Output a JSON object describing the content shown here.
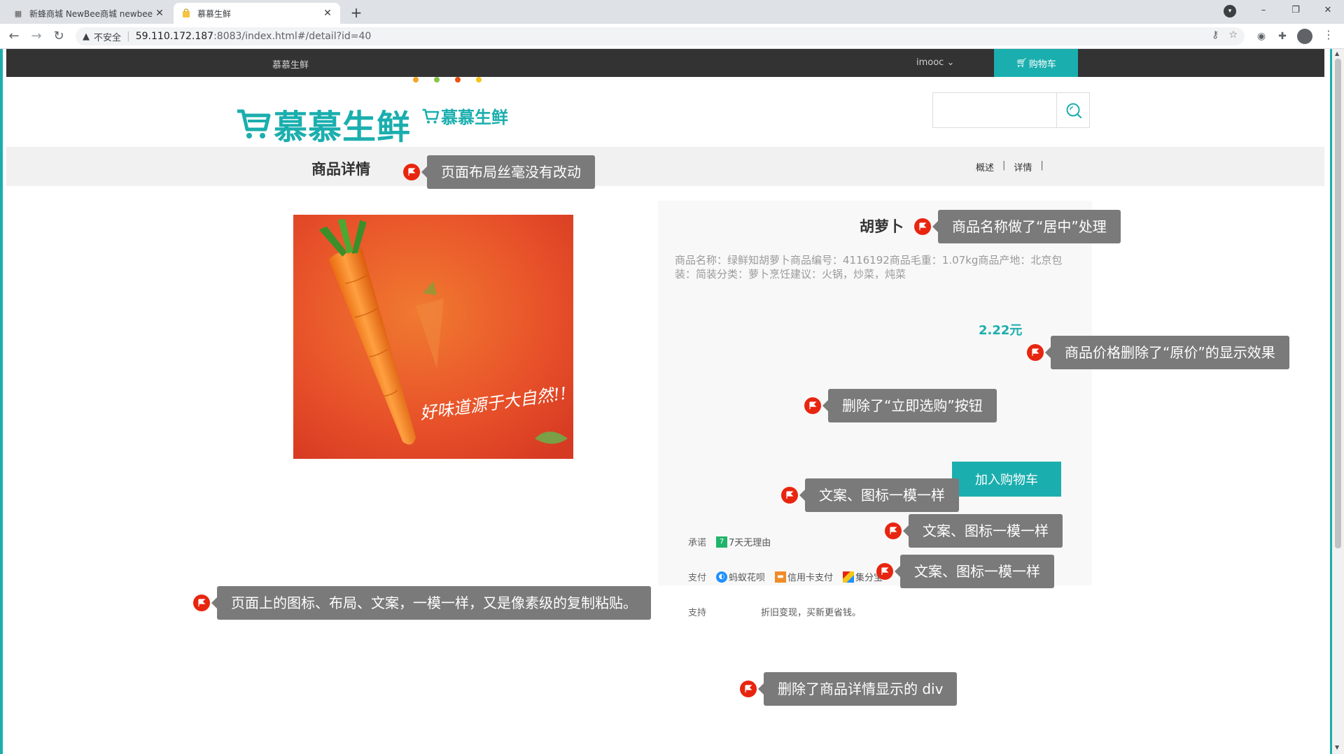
{
  "browser": {
    "tabs": [
      {
        "title": "新蜂商城 NewBee商城 newbee",
        "active": false
      },
      {
        "title": "慕慕生鲜",
        "active": true
      }
    ],
    "new_tab": "+",
    "window_controls": {
      "minimize": "–",
      "restore": "❐",
      "close": "✕"
    },
    "address": {
      "security_label": "不安全",
      "host": "59.110.172.187",
      "path": ":8083/index.html#/detail?id=40"
    }
  },
  "site": {
    "nav": {
      "site_name": "慕慕生鲜",
      "user": "imooc",
      "cart": "购物车"
    },
    "logo_text": "慕慕生鲜",
    "logo_small_text": "慕慕生鲜",
    "search": {
      "placeholder": ""
    },
    "subbar": {
      "title": "商品详情",
      "links": [
        "概述",
        "详情"
      ],
      "separator": "|"
    },
    "product": {
      "name": "胡萝卜",
      "description": "商品名称：绿鲜知胡萝卜商品编号：4116192商品毛重：1.07kg商品产地：北京包装：简装分类：萝卜烹饪建议：火锅，炒菜，炖菜",
      "price": "2.22元",
      "add_to_cart": "加入购物车",
      "image_caption": "好味道源于大自然!!",
      "services": {
        "promise_label": "承诺",
        "promise_item": "7天无理由",
        "pay_label": "支付",
        "pay_items": [
          "蚂蚁花呗",
          "信用卡支付",
          "集分宝"
        ],
        "support_label": "支持",
        "support_text": "折旧变现，买新更省钱。"
      }
    }
  },
  "annotations": [
    "页面布局丝毫没有改动",
    "商品名称做了“居中”处理",
    "商品价格删除了“原价”的显示效果",
    "删除了“立即选购”按钮",
    "文案、图标一模一样",
    "文案、图标一模一样",
    "文案、图标一模一样",
    "页面上的图标、布局、文案，一模一样，又是像素级的复制粘贴。",
    "删除了商品详情显示的 div"
  ],
  "colors": {
    "brand": "#1baeae",
    "nav_bg": "#333333",
    "annotation_flag": "#e8250f",
    "annotation_bubble": "#7a7a7a"
  }
}
